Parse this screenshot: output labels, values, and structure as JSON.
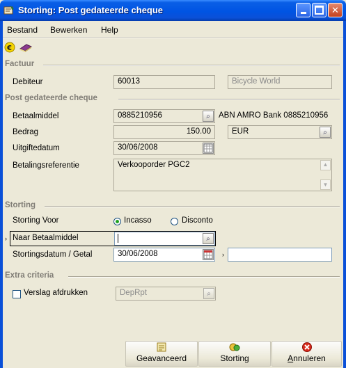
{
  "window": {
    "title": "Storting: Post gedateerde cheque"
  },
  "menu": [
    "Bestand",
    "Bewerken",
    "Help"
  ],
  "toolbar": {
    "icons": [
      "euro-icon",
      "book-icon"
    ]
  },
  "sections": {
    "factuur": "Factuur",
    "cheque": "Post gedateerde cheque",
    "storting": "Storting",
    "extra": "Extra criteria"
  },
  "factuur": {
    "debiteur_label": "Debiteur",
    "debiteur_value": "60013",
    "debiteur_name": "Bicycle World"
  },
  "cheque": {
    "betaalmiddel_label": "Betaalmiddel",
    "betaalmiddel_value": "0885210956",
    "betaalmiddel_desc": "ABN AMRO Bank 0885210956",
    "bedrag_label": "Bedrag",
    "bedrag_value": "150.00",
    "currency": "EUR",
    "uitgiftedatum_label": "Uitgiftedatum",
    "uitgiftedatum_value": "30/06/2008",
    "referentie_label": "Betalingsreferentie",
    "referentie_value": "Verkooporder PGC2"
  },
  "storting": {
    "voor_label": "Storting Voor",
    "option_incasso": "Incasso",
    "option_disconto": "Disconto",
    "selected": "Incasso",
    "naar_label": "Naar Betaalmiddel",
    "naar_value": "",
    "datum_label": "Stortingsdatum / Getal",
    "datum_value": "30/06/2008",
    "getal_value": ""
  },
  "extra": {
    "verslag_label": "Verslag afdrukken",
    "verslag_checked": false,
    "report_value": "DepRpt"
  },
  "buttons": {
    "advanced": "Geavanceerd",
    "deposit": "Storting",
    "cancel": "Annuleren"
  },
  "colors": {
    "titlebar": "#0054E3",
    "window_bg": "#ECE9D8",
    "section_text": "#807D76"
  }
}
